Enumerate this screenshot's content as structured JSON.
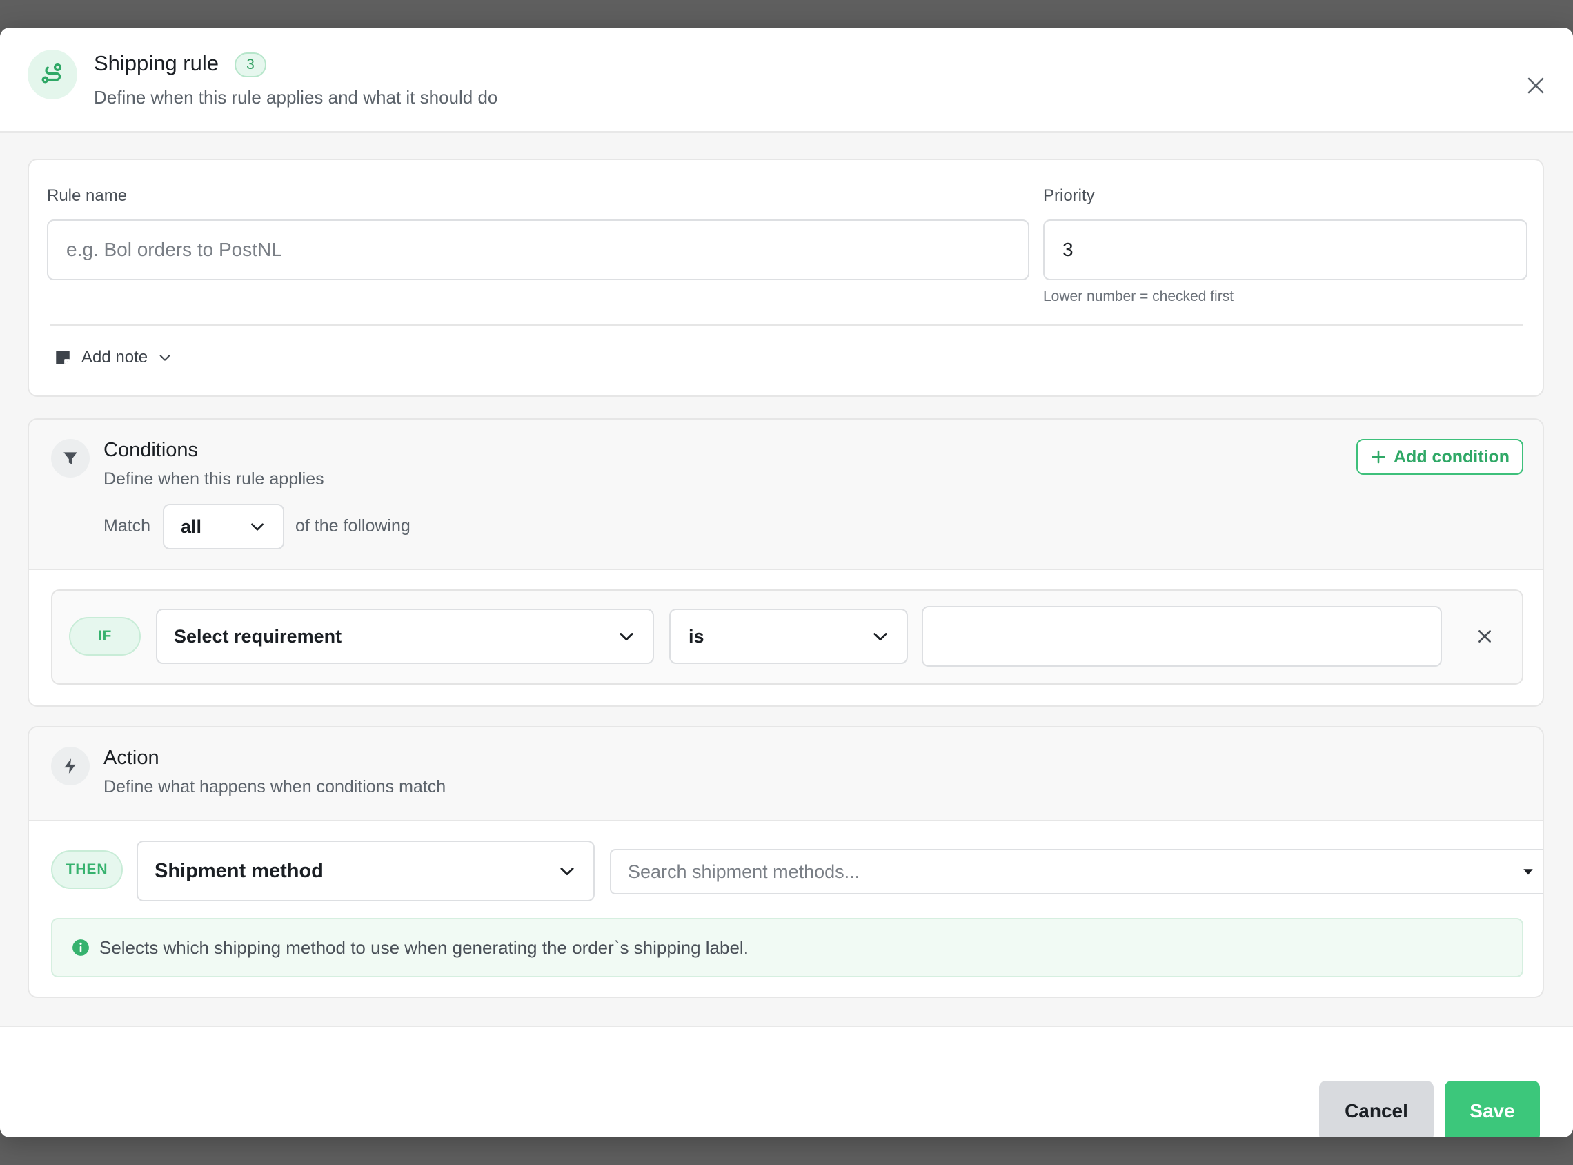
{
  "header": {
    "title": "Shipping rule",
    "badge": "3",
    "subtitle": "Define when this rule applies and what it should do",
    "icon": "route-icon",
    "close_icon": "close-icon"
  },
  "rule": {
    "name_label": "Rule name",
    "name_placeholder": "e.g. Bol orders to PostNL",
    "name_value": "",
    "priority_label": "Priority",
    "priority_value": "3",
    "priority_hint": "Lower number = checked first",
    "add_note_label": "Add note"
  },
  "conditions": {
    "title": "Conditions",
    "subtitle": "Define when this rule applies",
    "add_button": "Add condition",
    "match_prefix": "Match",
    "match_value": "all",
    "match_suffix": "of the following",
    "rows": [
      {
        "keyword": "IF",
        "requirement": "Select requirement",
        "operator": "is",
        "value": ""
      }
    ]
  },
  "action": {
    "title": "Action",
    "subtitle": "Define what happens when conditions match",
    "keyword": "THEN",
    "type": "Shipment method",
    "search_placeholder": "Search shipment methods...",
    "info": "Selects which shipping method to use when generating the order`s shipping label."
  },
  "footer": {
    "cancel": "Cancel",
    "save": "Save"
  },
  "colors": {
    "accent": "#3cc77b",
    "accent_text": "#2fa866",
    "cancel_bg": "#d8dade"
  }
}
